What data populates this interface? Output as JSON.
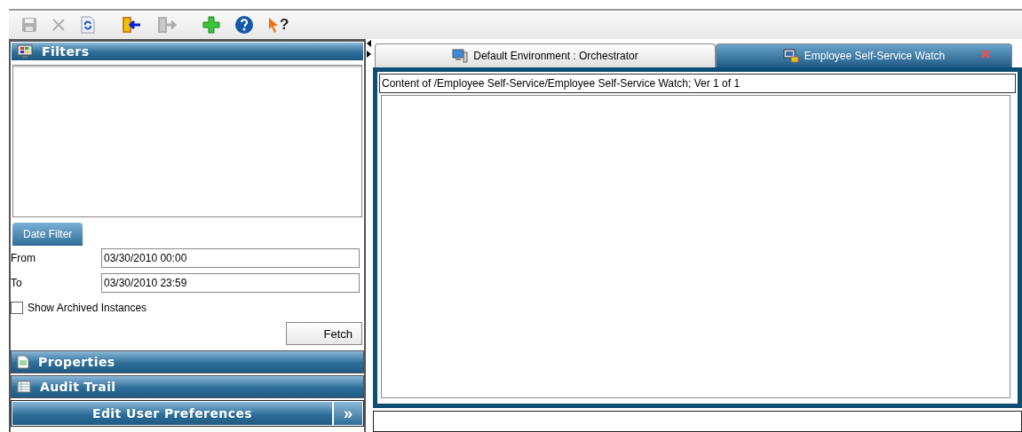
{
  "toolbar": [
    {
      "kind": "save",
      "disabled": true
    },
    {
      "kind": "close",
      "disabled": true
    },
    {
      "kind": "refresh",
      "disabled": false
    },
    {
      "kind": "check-in",
      "disabled": false
    },
    {
      "kind": "check-out",
      "disabled": true
    },
    {
      "kind": "add",
      "disabled": false
    },
    {
      "kind": "help",
      "disabled": false
    },
    {
      "kind": "context-help",
      "disabled": false,
      "label": "?"
    }
  ],
  "sidebar": {
    "filters": {
      "title": "Filters",
      "date_filter_tab": "Date Filter",
      "fields": [
        {
          "label": "From",
          "value": "03/30/2010 00:00"
        },
        {
          "label": "To",
          "value": "03/30/2010 23:59"
        }
      ],
      "show_archived": {
        "label": "Show Archived Instances",
        "checked": false
      },
      "fetch_button": "Fetch"
    },
    "sections": [
      {
        "kind": "properties",
        "title": "Properties"
      },
      {
        "kind": "audit",
        "title": "Audit Trail"
      }
    ],
    "preferences_button": "Edit User Preferences",
    "more_button": "»"
  },
  "tabs": [
    {
      "kind": "environment",
      "label": "Default Environment : Orchestrator",
      "selected": false,
      "closable": false
    },
    {
      "kind": "watch",
      "label": "Employee Self-Service Watch",
      "selected": true,
      "closable": true
    }
  ],
  "content": {
    "path": "Content of /Employee Self-Service/Employee Self-Service Watch; Ver 1 of 1"
  }
}
